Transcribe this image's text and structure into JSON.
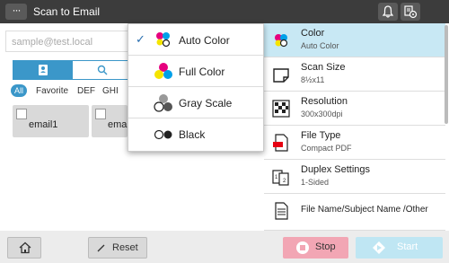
{
  "topbar": {
    "menu_label": "···",
    "title": "Scan to Email"
  },
  "left": {
    "input_placeholder": "sample@test.local",
    "index_tabs": [
      "All",
      "Favorite",
      "DEF",
      "GHI"
    ],
    "entries": [
      "email1",
      "ema"
    ]
  },
  "dropdown": {
    "items": [
      {
        "label": "Auto Color",
        "checked": true
      },
      {
        "label": "Full Color",
        "checked": false
      },
      {
        "label": "Gray Scale",
        "checked": false
      },
      {
        "label": "Black",
        "checked": false
      }
    ]
  },
  "settings": [
    {
      "title": "Color",
      "value": "Auto Color",
      "icon": "color-icon"
    },
    {
      "title": "Scan Size",
      "value": "8½x11",
      "icon": "page-size-icon"
    },
    {
      "title": "Resolution",
      "value": "300x300dpi",
      "icon": "resolution-icon"
    },
    {
      "title": "File Type",
      "value": "Compact PDF",
      "icon": "pdf-file-icon"
    },
    {
      "title": "Duplex Settings",
      "value": "1-Sided",
      "icon": "duplex-icon"
    },
    {
      "title": "File Name/Subject Name /Other",
      "value": "",
      "icon": "document-icon"
    }
  ],
  "bottom": {
    "reset_label": "Reset",
    "stop_label": "Stop",
    "start_label": "Start"
  },
  "colors": {
    "accent": "#3b97c9",
    "selected_row": "#c8e8f4",
    "stop": "#f2a6b4",
    "start": "#bfe6f3"
  }
}
